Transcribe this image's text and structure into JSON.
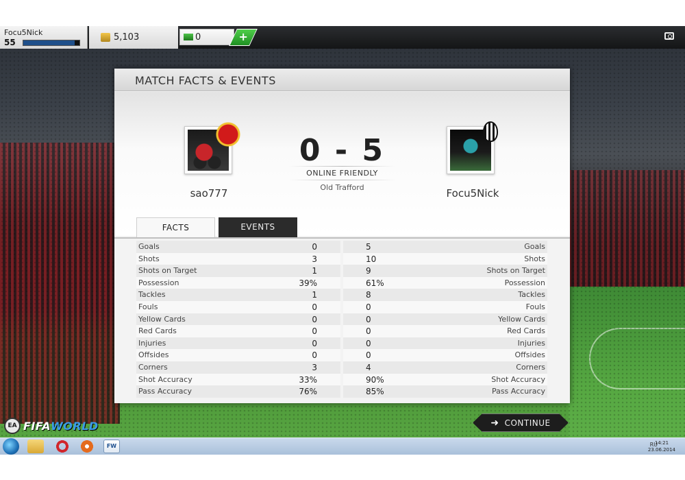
{
  "topbar": {
    "user_name": "Focu5Nick",
    "user_level": "55",
    "xp_progress": 0.92,
    "coins": "5,103",
    "cash": "0",
    "add_label": "+"
  },
  "panel": {
    "title": "MATCH FACTS & EVENTS",
    "home_name": "sao777",
    "away_name": "Focu5Nick",
    "score": "0 - 5",
    "match_type": "ONLINE FRIENDLY",
    "stadium": "Old Trafford",
    "tabs": {
      "facts": "FACTS",
      "events": "EVENTS"
    }
  },
  "stats": [
    {
      "label": "Goals",
      "home": "0",
      "away": "5"
    },
    {
      "label": "Shots",
      "home": "3",
      "away": "10"
    },
    {
      "label": "Shots on Target",
      "home": "1",
      "away": "9"
    },
    {
      "label": "Possession",
      "home": "39%",
      "away": "61%"
    },
    {
      "label": "Tackles",
      "home": "1",
      "away": "8"
    },
    {
      "label": "Fouls",
      "home": "0",
      "away": "0"
    },
    {
      "label": "Yellow Cards",
      "home": "0",
      "away": "0"
    },
    {
      "label": "Red Cards",
      "home": "0",
      "away": "0"
    },
    {
      "label": "Injuries",
      "home": "0",
      "away": "0"
    },
    {
      "label": "Offsides",
      "home": "0",
      "away": "0"
    },
    {
      "label": "Corners",
      "home": "3",
      "away": "4"
    },
    {
      "label": "Shot Accuracy",
      "home": "33%",
      "away": "90%"
    },
    {
      "label": "Pass Accuracy",
      "home": "76%",
      "away": "85%"
    }
  ],
  "continue_label": "CONTINUE",
  "logo": {
    "ea": "EA",
    "fifa": "FIFA",
    "world": "WORLD"
  },
  "taskbar": {
    "fw_label": "FW",
    "lang": "RU",
    "time": "14:21",
    "date": "23.06.2014"
  },
  "icons": [
    "camera-icon",
    "coins-icon",
    "cash-icon",
    "arrow-right-icon",
    "windows-start-icon",
    "folder-icon",
    "opera-icon"
  ]
}
